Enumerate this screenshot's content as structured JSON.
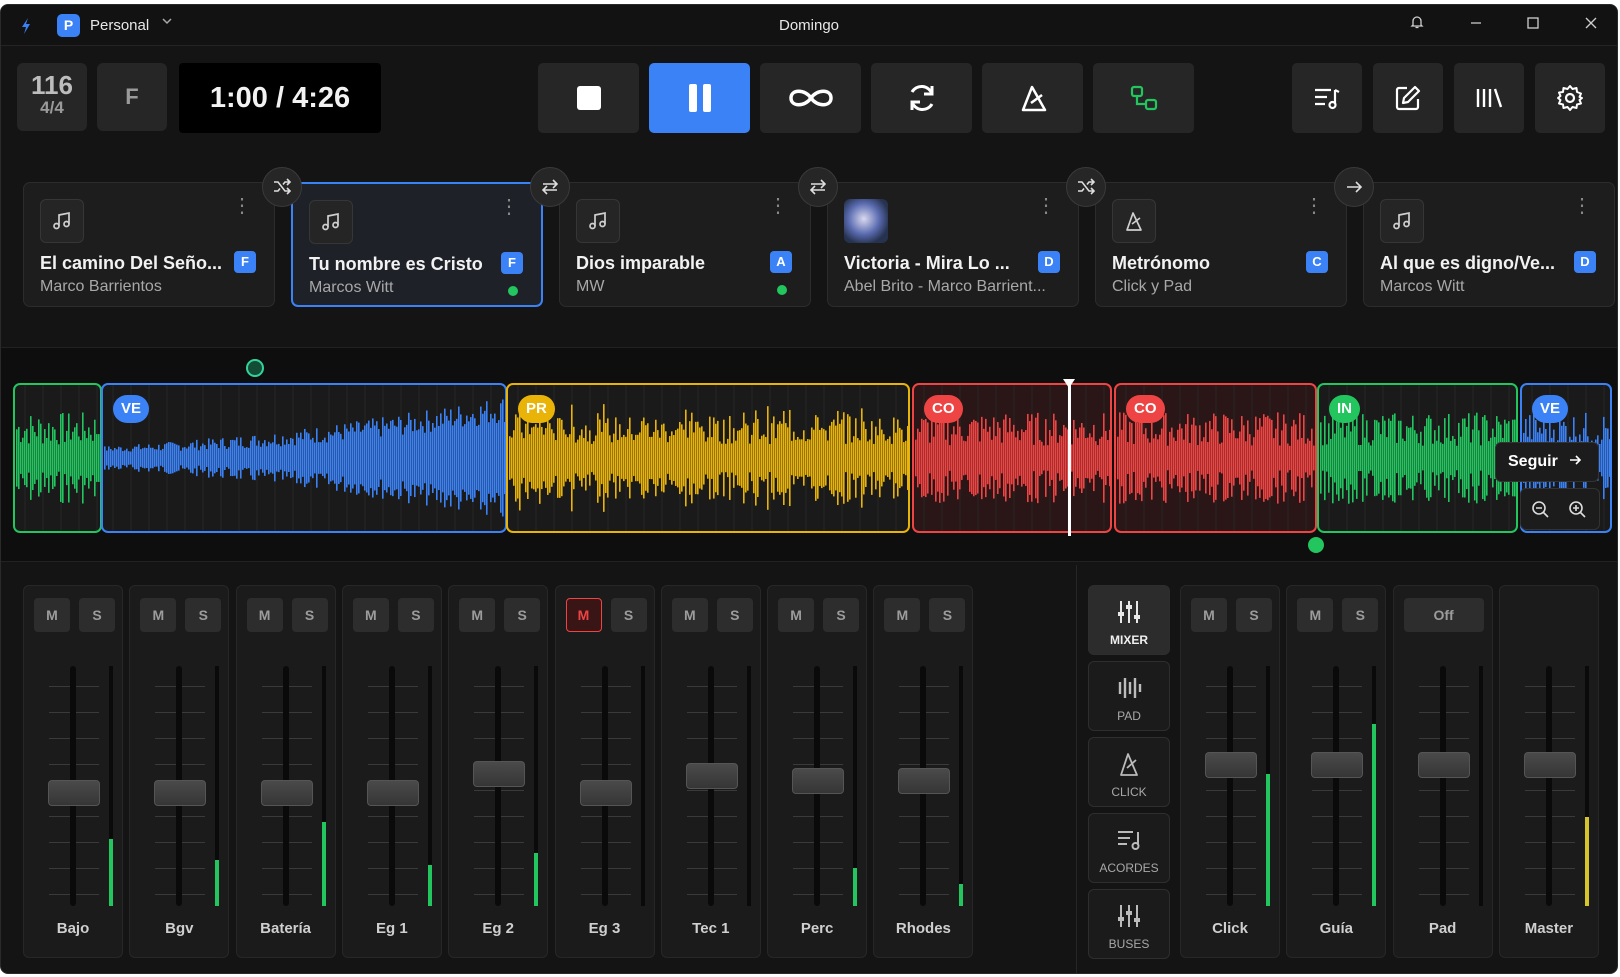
{
  "titlebar": {
    "workspace_initial": "P",
    "workspace_name": "Personal",
    "window_title": "Domingo"
  },
  "transport": {
    "tempo": "116",
    "time_signature": "4/4",
    "key": "F",
    "time": "1:00 / 4:26",
    "buttons": [
      "stop-icon",
      "pause-icon",
      "loop-icon",
      "refresh-icon",
      "metronome-icon",
      "routing-icon"
    ],
    "active_button": "pause-icon"
  },
  "right_tools": [
    "setlist-icon",
    "edit-icon",
    "library-icon",
    "settings-icon"
  ],
  "setlist": [
    {
      "title": "El camino Del Seño...",
      "artist": "Marco Barrientos",
      "key": "F",
      "icon": "music-note-icon",
      "live": false
    },
    {
      "title": "Tu nombre es Cristo",
      "artist": "Marcos Witt",
      "key": "F",
      "icon": "music-note-icon",
      "live": true,
      "selected": true
    },
    {
      "title": "Dios imparable",
      "artist": "MW",
      "key": "A",
      "icon": "music-note-icon",
      "live": true
    },
    {
      "title": "Victoria - Mira Lo ...",
      "artist": "Abel Brito - Marco Barrient...",
      "key": "D",
      "icon": "album-art",
      "live": false
    },
    {
      "title": "Metrónomo",
      "artist": "Click y Pad",
      "key": "C",
      "icon": "metronome-icon",
      "live": false
    },
    {
      "title": "Al que es digno/Ve...",
      "artist": "Marcos Witt",
      "key": "D",
      "icon": "music-note-icon",
      "live": false
    }
  ],
  "transitions": [
    "shuffle-icon",
    "swap-icon",
    "swap-icon",
    "shuffle-icon",
    "arrow-right-icon"
  ],
  "sections": [
    {
      "label": "",
      "color": "#22c55e"
    },
    {
      "label": "VE",
      "color": "#3b82f6"
    },
    {
      "label": "PR",
      "color": "#eab308"
    },
    {
      "label": "CO",
      "color": "#ef4444"
    },
    {
      "label": "CO",
      "color": "#ef4444"
    },
    {
      "label": "IN",
      "color": "#22c55e"
    },
    {
      "label": "VE",
      "color": "#3b82f6"
    }
  ],
  "waveform": {
    "follow_label": "Seguir",
    "zoom_out_icon": "zoom-out-icon",
    "zoom_in_icon": "zoom-in-icon"
  },
  "mixer": {
    "mute_label": "M",
    "solo_label": "S",
    "off_label": "Off",
    "channels": [
      {
        "name": "Bajo",
        "muted": false,
        "level": 0.45,
        "meter": 0.28,
        "meter_color": "#22c55e"
      },
      {
        "name": "Bgv",
        "muted": false,
        "level": 0.45,
        "meter": 0.19,
        "meter_color": "#22c55e"
      },
      {
        "name": "Batería",
        "muted": false,
        "level": 0.45,
        "meter": 0.35,
        "meter_color": "#22c55e"
      },
      {
        "name": "Eg 1",
        "muted": false,
        "level": 0.45,
        "meter": 0.17,
        "meter_color": "#22c55e"
      },
      {
        "name": "Eg 2",
        "muted": false,
        "level": 0.53,
        "meter": 0.22,
        "meter_color": "#22c55e"
      },
      {
        "name": "Eg 3",
        "muted": true,
        "level": 0.45,
        "meter": 0.0,
        "meter_color": "#22c55e"
      },
      {
        "name": "Tec 1",
        "muted": false,
        "level": 0.52,
        "meter": 0.0,
        "meter_color": "#22c55e"
      },
      {
        "name": "Perc",
        "muted": false,
        "level": 0.5,
        "meter": 0.16,
        "meter_color": "#22c55e"
      },
      {
        "name": "Rhodes",
        "muted": false,
        "level": 0.5,
        "meter": 0.09,
        "meter_color": "#22c55e"
      }
    ],
    "side_tabs": [
      {
        "label": "MIXER",
        "icon": "mixer-icon",
        "active": true
      },
      {
        "label": "PAD",
        "icon": "pad-icon",
        "active": false
      },
      {
        "label": "CLICK",
        "icon": "metronome-icon",
        "active": false
      },
      {
        "label": "ACORDES",
        "icon": "chords-icon",
        "active": false
      },
      {
        "label": "BUSES",
        "icon": "buses-icon",
        "active": false
      }
    ],
    "outputs": [
      {
        "name": "Click",
        "has_ms": true,
        "level": 0.57,
        "meter": 0.55,
        "meter_color": "#22c55e"
      },
      {
        "name": "Guía",
        "has_ms": true,
        "level": 0.57,
        "meter": 0.76,
        "meter_color": "#22c55e"
      },
      {
        "name": "Pad",
        "has_ms": false,
        "level": 0.57,
        "meter": 0.0,
        "meter_color": "#22c55e"
      },
      {
        "name": "Master",
        "has_ms": false,
        "level": 0.57,
        "meter": 0.37,
        "meter_color": "#d6c52a"
      }
    ]
  }
}
